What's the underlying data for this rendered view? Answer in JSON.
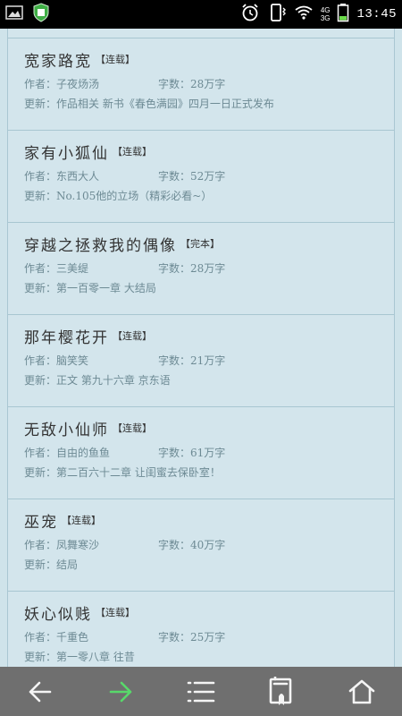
{
  "status_bar": {
    "time": "13:45",
    "network_top": "4G",
    "network_bottom": "3G"
  },
  "novels": [
    {
      "title": "宽家路宽",
      "status": "【连载】",
      "author": "作者：子夜炀汤",
      "words": "字数：28万字",
      "update": "更新：作品相关   新书《春色满园》四月一日正式发布"
    },
    {
      "title": "家有小狐仙",
      "status": "【连载】",
      "author": "作者：东西大人",
      "words": "字数：52万字",
      "update": "更新：No.105他的立场（精彩必看~）"
    },
    {
      "title": "穿越之拯救我的偶像",
      "status": "【完本】",
      "author": "作者：三美缇",
      "words": "字数：28万字",
      "update": "更新：第一百零一章 大结局"
    },
    {
      "title": "那年樱花开",
      "status": "【连载】",
      "author": "作者：脑笑笑",
      "words": "字数：21万字",
      "update": "更新：正文   第九十六章 京东语"
    },
    {
      "title": "无敌小仙师",
      "status": "【连载】",
      "author": "作者：自由的鱼鱼",
      "words": "字数：61万字",
      "update": "更新：第二百六十二章 让闺蜜去保卧室！"
    },
    {
      "title": "巫宠",
      "status": "【连载】",
      "author": "作者：凤舞寒沙",
      "words": "字数：40万字",
      "update": "更新：结局"
    },
    {
      "title": "妖心似贱",
      "status": "【连载】",
      "author": "作者：千重色",
      "words": "字数：25万字",
      "update": "更新：第一零八章 往昔"
    }
  ],
  "icons": {
    "status_left": [
      "image-icon",
      "shield-icon"
    ],
    "status_right": [
      "alarm-icon",
      "vibrate-icon",
      "wifi-icon",
      "battery-icon"
    ],
    "nav": [
      "back-arrow-icon",
      "forward-arrow-icon",
      "menu-icon",
      "bookmark-icon",
      "home-icon"
    ]
  },
  "colors": {
    "forward_active": "#58d86a",
    "background": "#cfe3ea"
  }
}
